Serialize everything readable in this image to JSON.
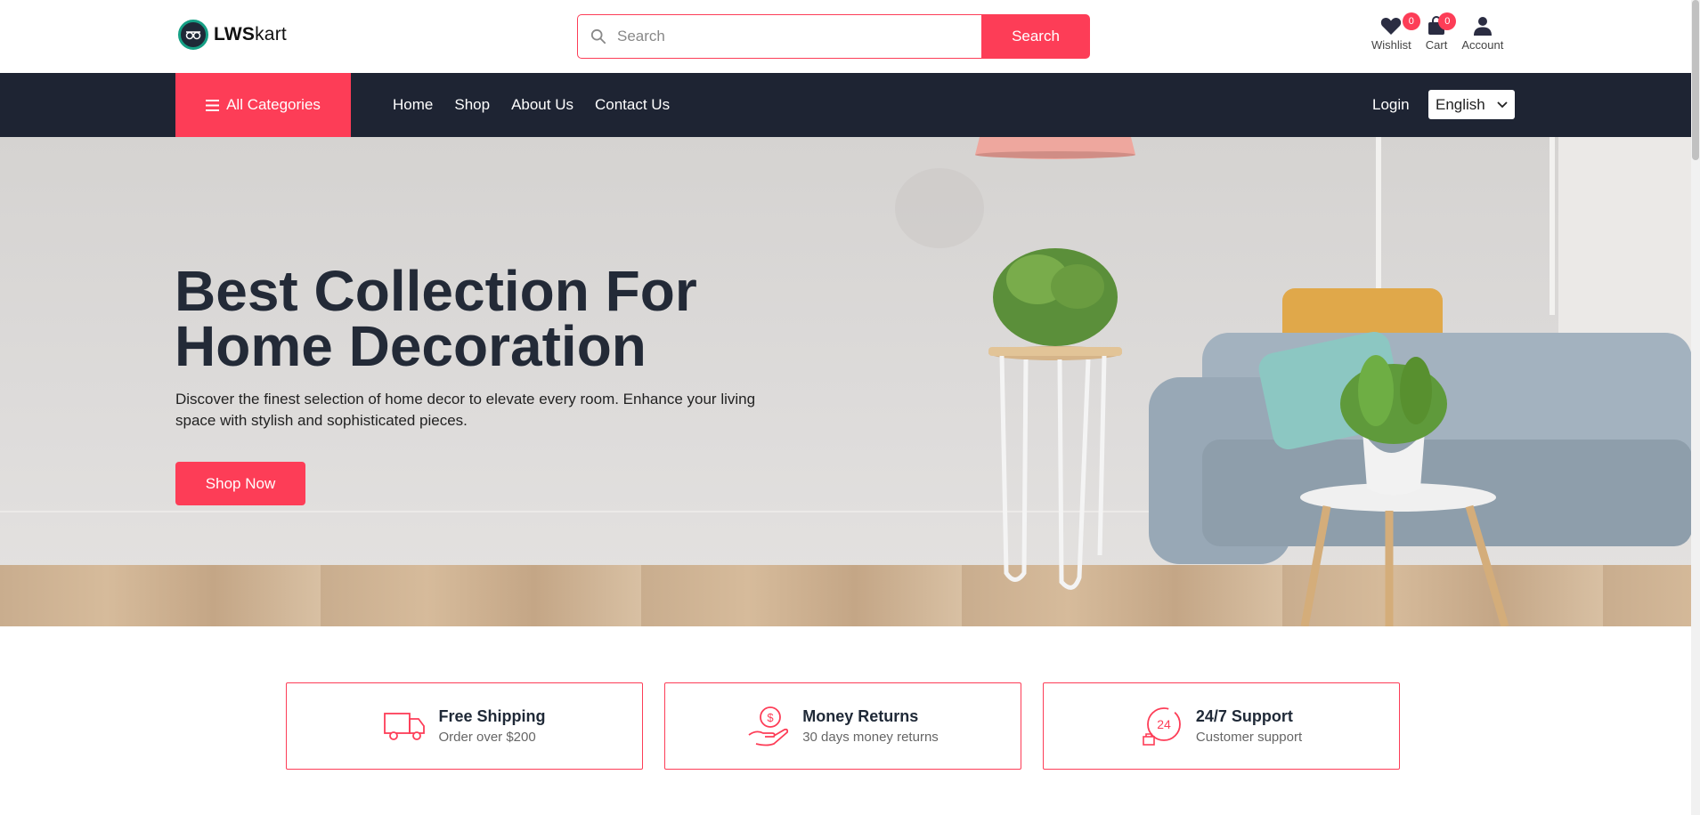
{
  "header": {
    "logo_bold": "LWS",
    "logo_light": "kart",
    "search_placeholder": "Search",
    "search_button": "Search",
    "wishlist_label": "Wishlist",
    "wishlist_count": "0",
    "cart_label": "Cart",
    "cart_count": "0",
    "account_label": "Account"
  },
  "navbar": {
    "all_categories": "All Categories",
    "links": [
      "Home",
      "Shop",
      "About Us",
      "Contact Us"
    ],
    "login": "Login",
    "language": "English"
  },
  "hero": {
    "title_line1": "Best Collection For",
    "title_line2": "Home Decoration",
    "description": "Discover the finest selection of home decor to elevate every room. Enhance your living space with stylish and sophisticated pieces.",
    "cta": "Shop Now"
  },
  "features": [
    {
      "title": "Free Shipping",
      "subtitle": "Order over $200",
      "icon": "delivery-truck-icon"
    },
    {
      "title": "Money Returns",
      "subtitle": "30 days money returns",
      "icon": "money-return-icon"
    },
    {
      "title": "24/7 Support",
      "subtitle": "Customer support",
      "icon": "support-24-icon"
    }
  ],
  "colors": {
    "accent": "#fd3d57",
    "navbar": "#1e2433",
    "text_dark": "#232a37"
  }
}
